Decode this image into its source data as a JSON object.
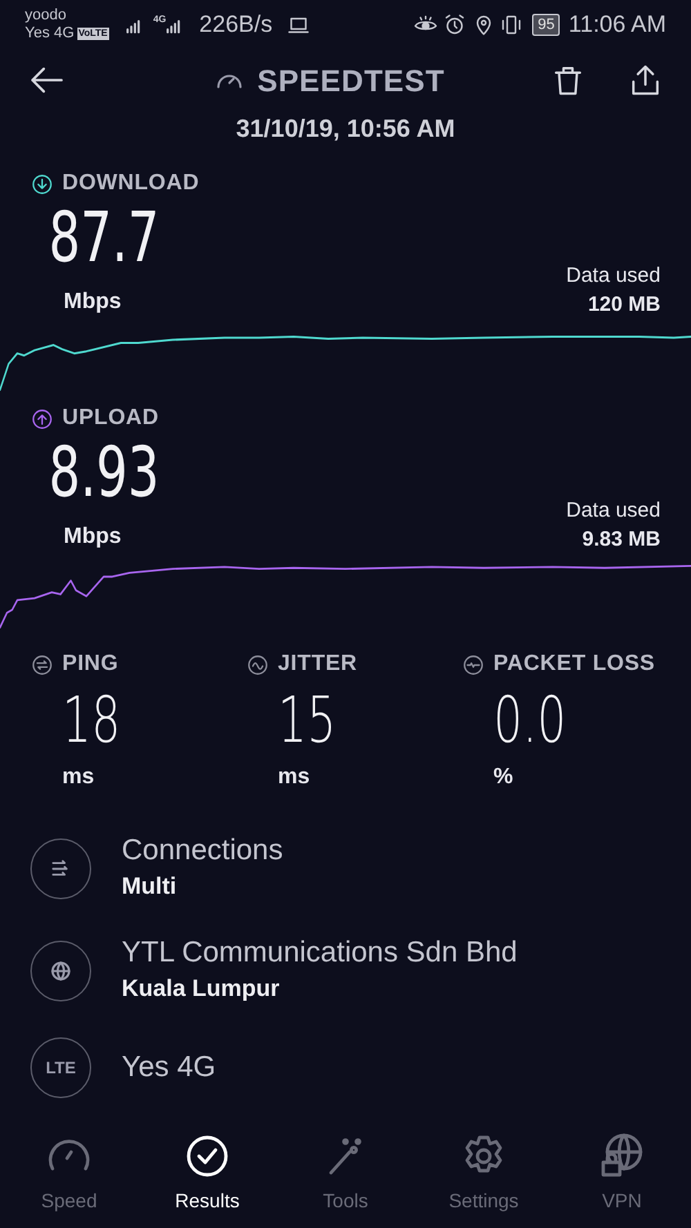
{
  "status_bar": {
    "carrier": "yoodo",
    "network": "Yes 4G",
    "volte": "VoLTE",
    "data_type": "4G",
    "speed": "226B/s",
    "battery": "95",
    "time": "11:06 AM"
  },
  "header": {
    "title": "SPEEDTEST",
    "date": "31/10/19, 10:56 AM"
  },
  "results": [
    {
      "label": "DOWNLOAD",
      "value": "87.7",
      "unit": "Mbps",
      "data_label": "Data used",
      "data_value": "120 MB",
      "color": "#4fd9cf"
    },
    {
      "label": "UPLOAD",
      "value": "8.93",
      "unit": "Mbps",
      "data_label": "Data used",
      "data_value": "9.83 MB",
      "color": "#a865ef"
    }
  ],
  "metrics": [
    {
      "label": "PING",
      "value": "18",
      "unit": "ms"
    },
    {
      "label": "JITTER",
      "value": "15",
      "unit": "ms"
    },
    {
      "label": "PACKET LOSS",
      "value": "0.0",
      "unit": "%"
    }
  ],
  "info_rows": [
    {
      "title": "Connections",
      "subtitle": "Multi"
    },
    {
      "title": "YTL Communications Sdn Bhd",
      "subtitle": "Kuala Lumpur"
    },
    {
      "badge": "LTE",
      "title": "Yes 4G"
    }
  ],
  "nav": [
    {
      "label": "Speed",
      "selected": false
    },
    {
      "label": "Results",
      "selected": true
    },
    {
      "label": "Tools",
      "selected": false
    },
    {
      "label": "Settings",
      "selected": false
    },
    {
      "label": "VPN",
      "selected": false
    }
  ]
}
